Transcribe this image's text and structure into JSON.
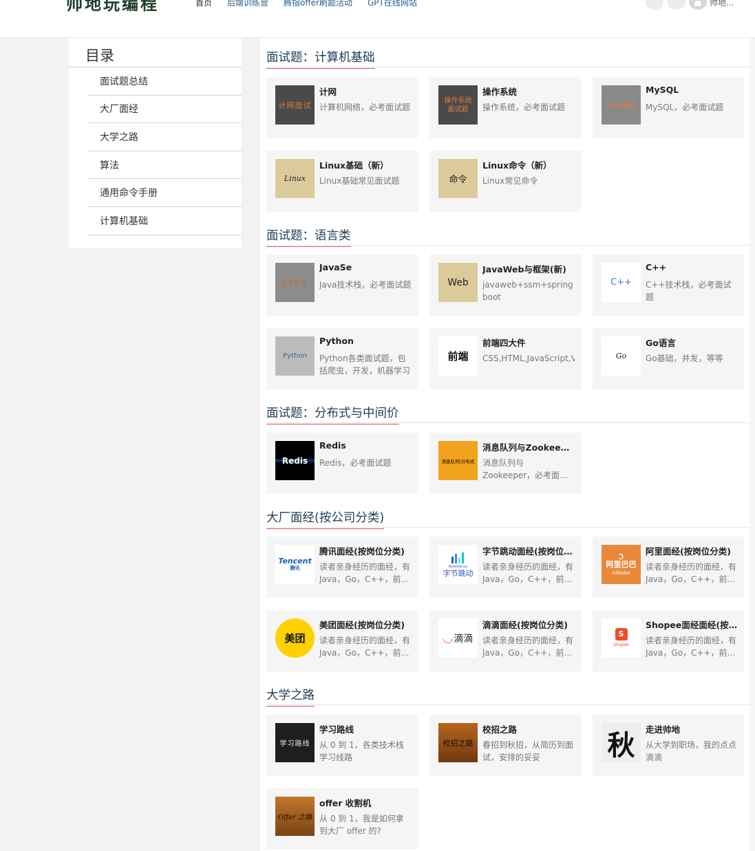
{
  "header": {
    "logo": "帅地玩编程",
    "nav": [
      "首页",
      "后端训练营",
      "腾指offer刷题活动",
      "GPT在线网站"
    ],
    "username": "帅地..."
  },
  "sidebar": {
    "title": "目录",
    "items": [
      "面试题总结",
      "大厂面经",
      "大学之路",
      "算法",
      "通用命令手册",
      "计算机基础"
    ]
  },
  "sections": [
    {
      "title": "面试题：计算机基础",
      "cards": [
        {
          "title": "计网",
          "desc": "计算机网络，必考面试题",
          "thumb": "计网面试",
          "icon": "network-interview-icon"
        },
        {
          "title": "操作系统",
          "desc": "操作系统，必考面试题",
          "thumb": "操作系统面试题",
          "icon": "os-interview-icon"
        },
        {
          "title": "MySQL",
          "desc": "MySQL，必考面试题",
          "thumb": "DB与缓存",
          "icon": "db-cache-icon"
        },
        {
          "title": "Linux基础（新）",
          "desc": "Linux基础常见面试题",
          "thumb": "Linux",
          "icon": "linux-icon"
        },
        {
          "title": "Linux命令（新）",
          "desc": "Linux常见命令",
          "thumb": "命令",
          "icon": "command-icon"
        }
      ]
    },
    {
      "title": "面试题：语言类",
      "cards": [
        {
          "title": "JavaSe",
          "desc": "Java技术栈，必考面试题",
          "thumb": "JAVA",
          "icon": "java-icon"
        },
        {
          "title": "JavaWeb与框架(新)",
          "desc": "javaweb+ssm+springboot",
          "thumb": "Web",
          "icon": "web-icon"
        },
        {
          "title": "C++",
          "desc": "C++技术栈，必考面试题",
          "thumb": "C++",
          "icon": "cpp-icon"
        },
        {
          "title": "Python",
          "desc": "Python各类面试题，包括爬虫，开发，机器学习",
          "thumb": "Python",
          "icon": "python-icon"
        },
        {
          "title": "前端四大件",
          "desc": "CSS,HTML,JavaScript,Vue",
          "thumb": "前端",
          "icon": "frontend-icon"
        },
        {
          "title": "Go语言",
          "desc": "Go基础，并发，等等",
          "thumb": "Go",
          "icon": "go-icon"
        }
      ]
    },
    {
      "title": "面试题：分布式与中间价",
      "cards": [
        {
          "title": "Redis",
          "desc": "Redis，必考面试题",
          "thumb": "Redis",
          "icon": "redis-icon"
        },
        {
          "title": "消息队列与Zookeeper",
          "desc": "消息队列与Zookeeper，必考面试题",
          "thumb": "消息队列|分布式",
          "icon": "mq-icon"
        }
      ]
    },
    {
      "title": "大厂面经(按公司分类)",
      "cards": [
        {
          "title": "腾讯面经(按岗位分类)",
          "desc": "读者亲身经历的面经，有Java，Go，C++，前端等",
          "thumb": "Tencent",
          "thumb2": "腾讯",
          "icon": "tencent-logo-icon"
        },
        {
          "title": "字节跳动面经(按岗位分类)",
          "desc": "读者亲身经历的面经，有Java，Go，C++，前端等",
          "thumb": "字节跳动",
          "thumb2": "ByteDance",
          "icon": "bytedance-logo-icon"
        },
        {
          "title": "阿里面经(按岗位分类)",
          "desc": "读者亲身经历的面经，有Java，Go，C++，前端等",
          "thumb": "阿里巴巴",
          "thumb2": "Alibaba",
          "icon": "alibaba-logo-icon"
        },
        {
          "title": "美团面经(按岗位分类)",
          "desc": "读者亲身经历的面经，有Java，Go，C++，前端等",
          "thumb": "美团",
          "icon": "meituan-logo-icon"
        },
        {
          "title": "滴滴面经(按岗位分类)",
          "desc": "读者亲身经历的面经，有Java，Go，C++，前端等",
          "thumb": "滴滴",
          "icon": "didi-logo-icon"
        },
        {
          "title": "Shopee面经面经(按岗位分类)",
          "desc": "读者亲身经历的面经，有Java，Go，C++，前端等",
          "thumb": "Shopee",
          "icon": "shopee-logo-icon"
        }
      ]
    },
    {
      "title": "大学之路",
      "cards": [
        {
          "title": "学习路线",
          "desc": "从 0 到 1，各类技术栈学习线路",
          "thumb": "学习路线",
          "icon": "learning-route-icon"
        },
        {
          "title": "校招之路",
          "desc": "春招到秋招，从简历到面试，安排的妥妥",
          "thumb": "校招之路",
          "icon": "campus-recruit-icon"
        },
        {
          "title": "走进帅地",
          "desc": "从大学到职场，我的点点滴滴",
          "thumb": "秋",
          "icon": "calligraphy-icon"
        },
        {
          "title": "offer 收割机",
          "desc": "从 0 到 1，我是如何拿到大厂 offer 的?",
          "thumb": "Offer 之路",
          "icon": "offer-road-icon"
        }
      ]
    }
  ]
}
